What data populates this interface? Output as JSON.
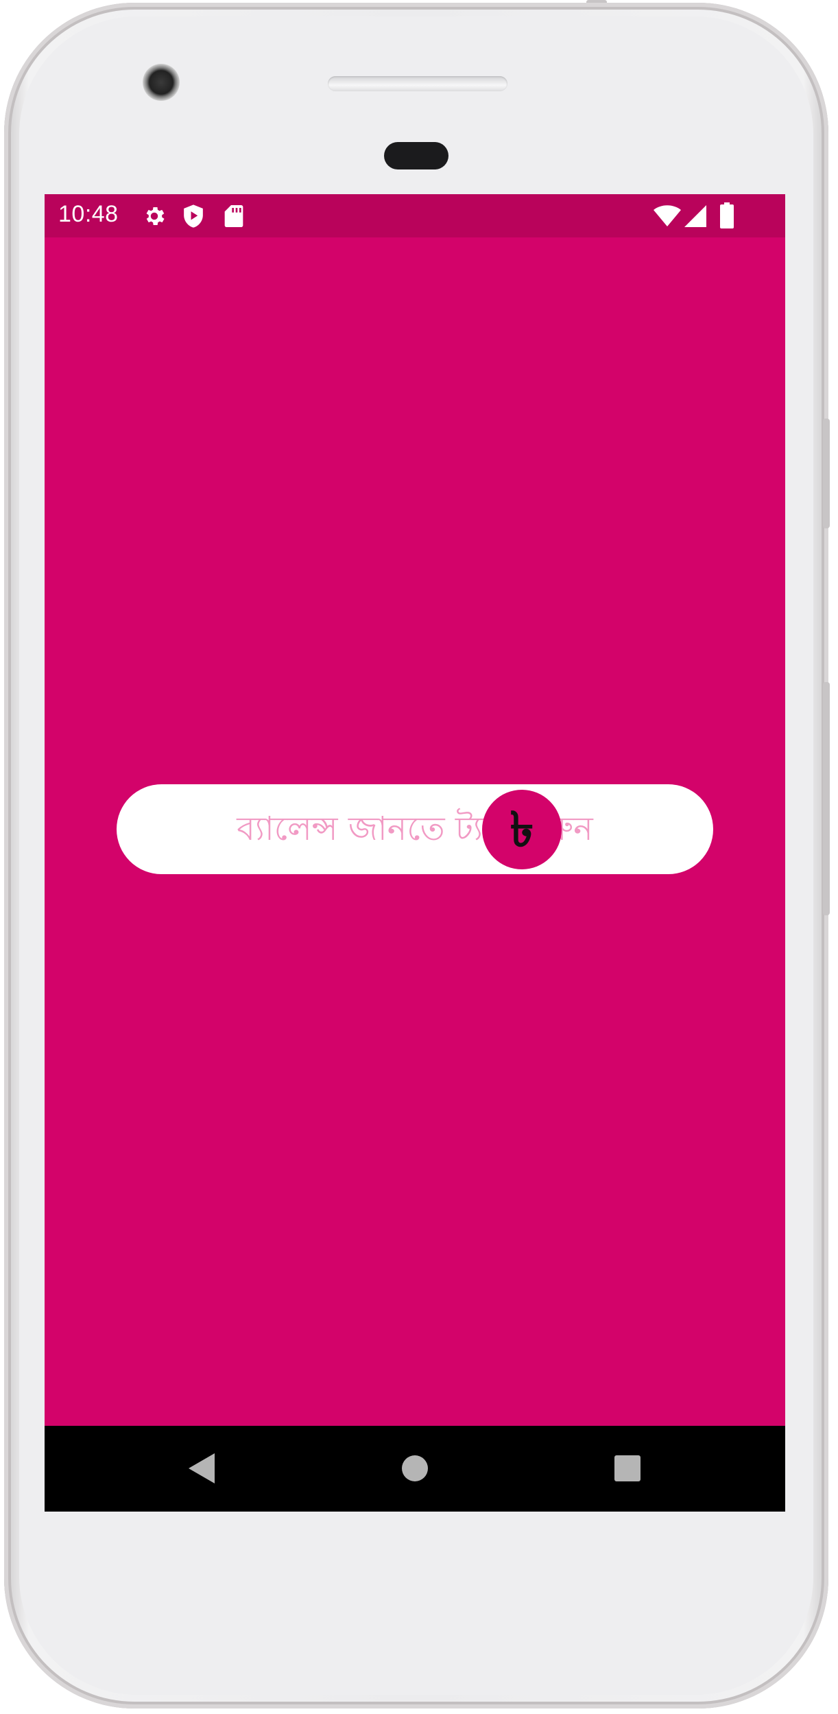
{
  "status_bar": {
    "time": "10:48",
    "icons_left": [
      "gear-icon",
      "shield-play-icon",
      "sd-card-icon"
    ],
    "icons_right": [
      "wifi-icon",
      "signal-icon",
      "battery-icon"
    ]
  },
  "balance": {
    "label": "ব্যালেন্স জানতে ট্যাপ করুন",
    "currency_symbol": "৳"
  },
  "nav_bar": {
    "back": "back-icon",
    "home": "home-icon",
    "recents": "recents-icon"
  },
  "colors": {
    "primary": "#d3036a",
    "status_bar": "#b9035b",
    "pill": "#ffffff",
    "pill_text": "#f19ac4",
    "nav_bar": "#000000"
  }
}
